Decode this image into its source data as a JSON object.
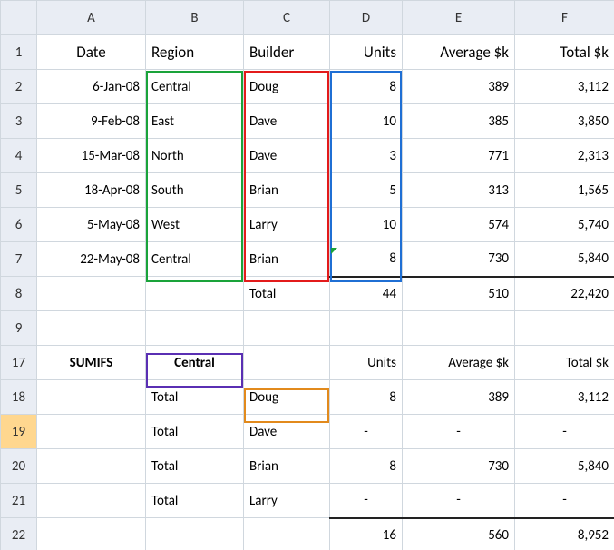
{
  "columns": [
    "A",
    "B",
    "C",
    "D",
    "E",
    "F"
  ],
  "header_row": "1",
  "headers": {
    "A": "Date",
    "B": "Region",
    "C": "Builder",
    "D": "Units",
    "E": "Average $k",
    "F": "Total $k"
  },
  "rows": [
    {
      "n": "2",
      "A": "6-Jan-08",
      "B": "Central",
      "C": "Doug",
      "D": "8",
      "E": "389",
      "F": "3,112"
    },
    {
      "n": "3",
      "A": "9-Feb-08",
      "B": "East",
      "C": "Dave",
      "D": "10",
      "E": "385",
      "F": "3,850"
    },
    {
      "n": "4",
      "A": "15-Mar-08",
      "B": "North",
      "C": "Dave",
      "D": "3",
      "E": "771",
      "F": "2,313"
    },
    {
      "n": "5",
      "A": "18-Apr-08",
      "B": "South",
      "C": "Brian",
      "D": "5",
      "E": "313",
      "F": "1,565"
    },
    {
      "n": "6",
      "A": "5-May-08",
      "B": "West",
      "C": "Larry",
      "D": "10",
      "E": "574",
      "F": "5,740"
    },
    {
      "n": "7",
      "A": "22-May-08",
      "B": "Central",
      "C": "Brian",
      "D": "8",
      "E": "730",
      "F": "5,840"
    }
  ],
  "total_row": {
    "n": "8",
    "C": "Total",
    "D": "44",
    "E": "510",
    "F": "22,420"
  },
  "blank_row": {
    "n": "9"
  },
  "sumifs_header": {
    "n": "17",
    "A": "SUMIFS",
    "B": "Central",
    "D": "Units",
    "E": "Average $k",
    "F": "Total $k"
  },
  "sumifs_rows": [
    {
      "n": "18",
      "B": "Total",
      "C": "Doug",
      "D": "8",
      "E": "389",
      "F": "3,112"
    },
    {
      "n": "19",
      "B": "Total",
      "C": "Dave",
      "D": "-",
      "E": "-",
      "F": "-",
      "sel": true
    },
    {
      "n": "20",
      "B": "Total",
      "C": "Brian",
      "D": "8",
      "E": "730",
      "F": "5,840"
    },
    {
      "n": "21",
      "B": "Total",
      "C": "Larry",
      "D": "-",
      "E": "-",
      "F": "-"
    }
  ],
  "sumifs_total": {
    "n": "22",
    "D": "16",
    "E": "560",
    "F": "8,952"
  },
  "chart_data": {
    "type": "table",
    "title": "SUMIFS example (Units, Average $k, Total $k by Date/Region/Builder)",
    "columns": [
      "Date",
      "Region",
      "Builder",
      "Units",
      "Average $k",
      "Total $k"
    ],
    "data": [
      [
        "6-Jan-08",
        "Central",
        "Doug",
        8,
        389,
        3112
      ],
      [
        "9-Feb-08",
        "East",
        "Dave",
        10,
        385,
        3850
      ],
      [
        "15-Mar-08",
        "North",
        "Dave",
        3,
        771,
        2313
      ],
      [
        "18-Apr-08",
        "South",
        "Brian",
        5,
        313,
        1565
      ],
      [
        "5-May-08",
        "West",
        "Larry",
        10,
        574,
        5740
      ],
      [
        "22-May-08",
        "Central",
        "Brian",
        8,
        730,
        5840
      ]
    ],
    "totals": {
      "Units": 44,
      "Average $k": 510,
      "Total $k": 22420
    },
    "sumifs_filter": {
      "Region": "Central"
    },
    "sumifs_result": [
      {
        "Builder": "Doug",
        "Units": 8,
        "Average $k": 389,
        "Total $k": 3112
      },
      {
        "Builder": "Dave",
        "Units": null,
        "Average $k": null,
        "Total $k": null
      },
      {
        "Builder": "Brian",
        "Units": 8,
        "Average $k": 730,
        "Total $k": 5840
      },
      {
        "Builder": "Larry",
        "Units": null,
        "Average $k": null,
        "Total $k": null
      }
    ],
    "sumifs_totals": {
      "Units": 16,
      "Average $k": 560,
      "Total $k": 8952
    }
  }
}
